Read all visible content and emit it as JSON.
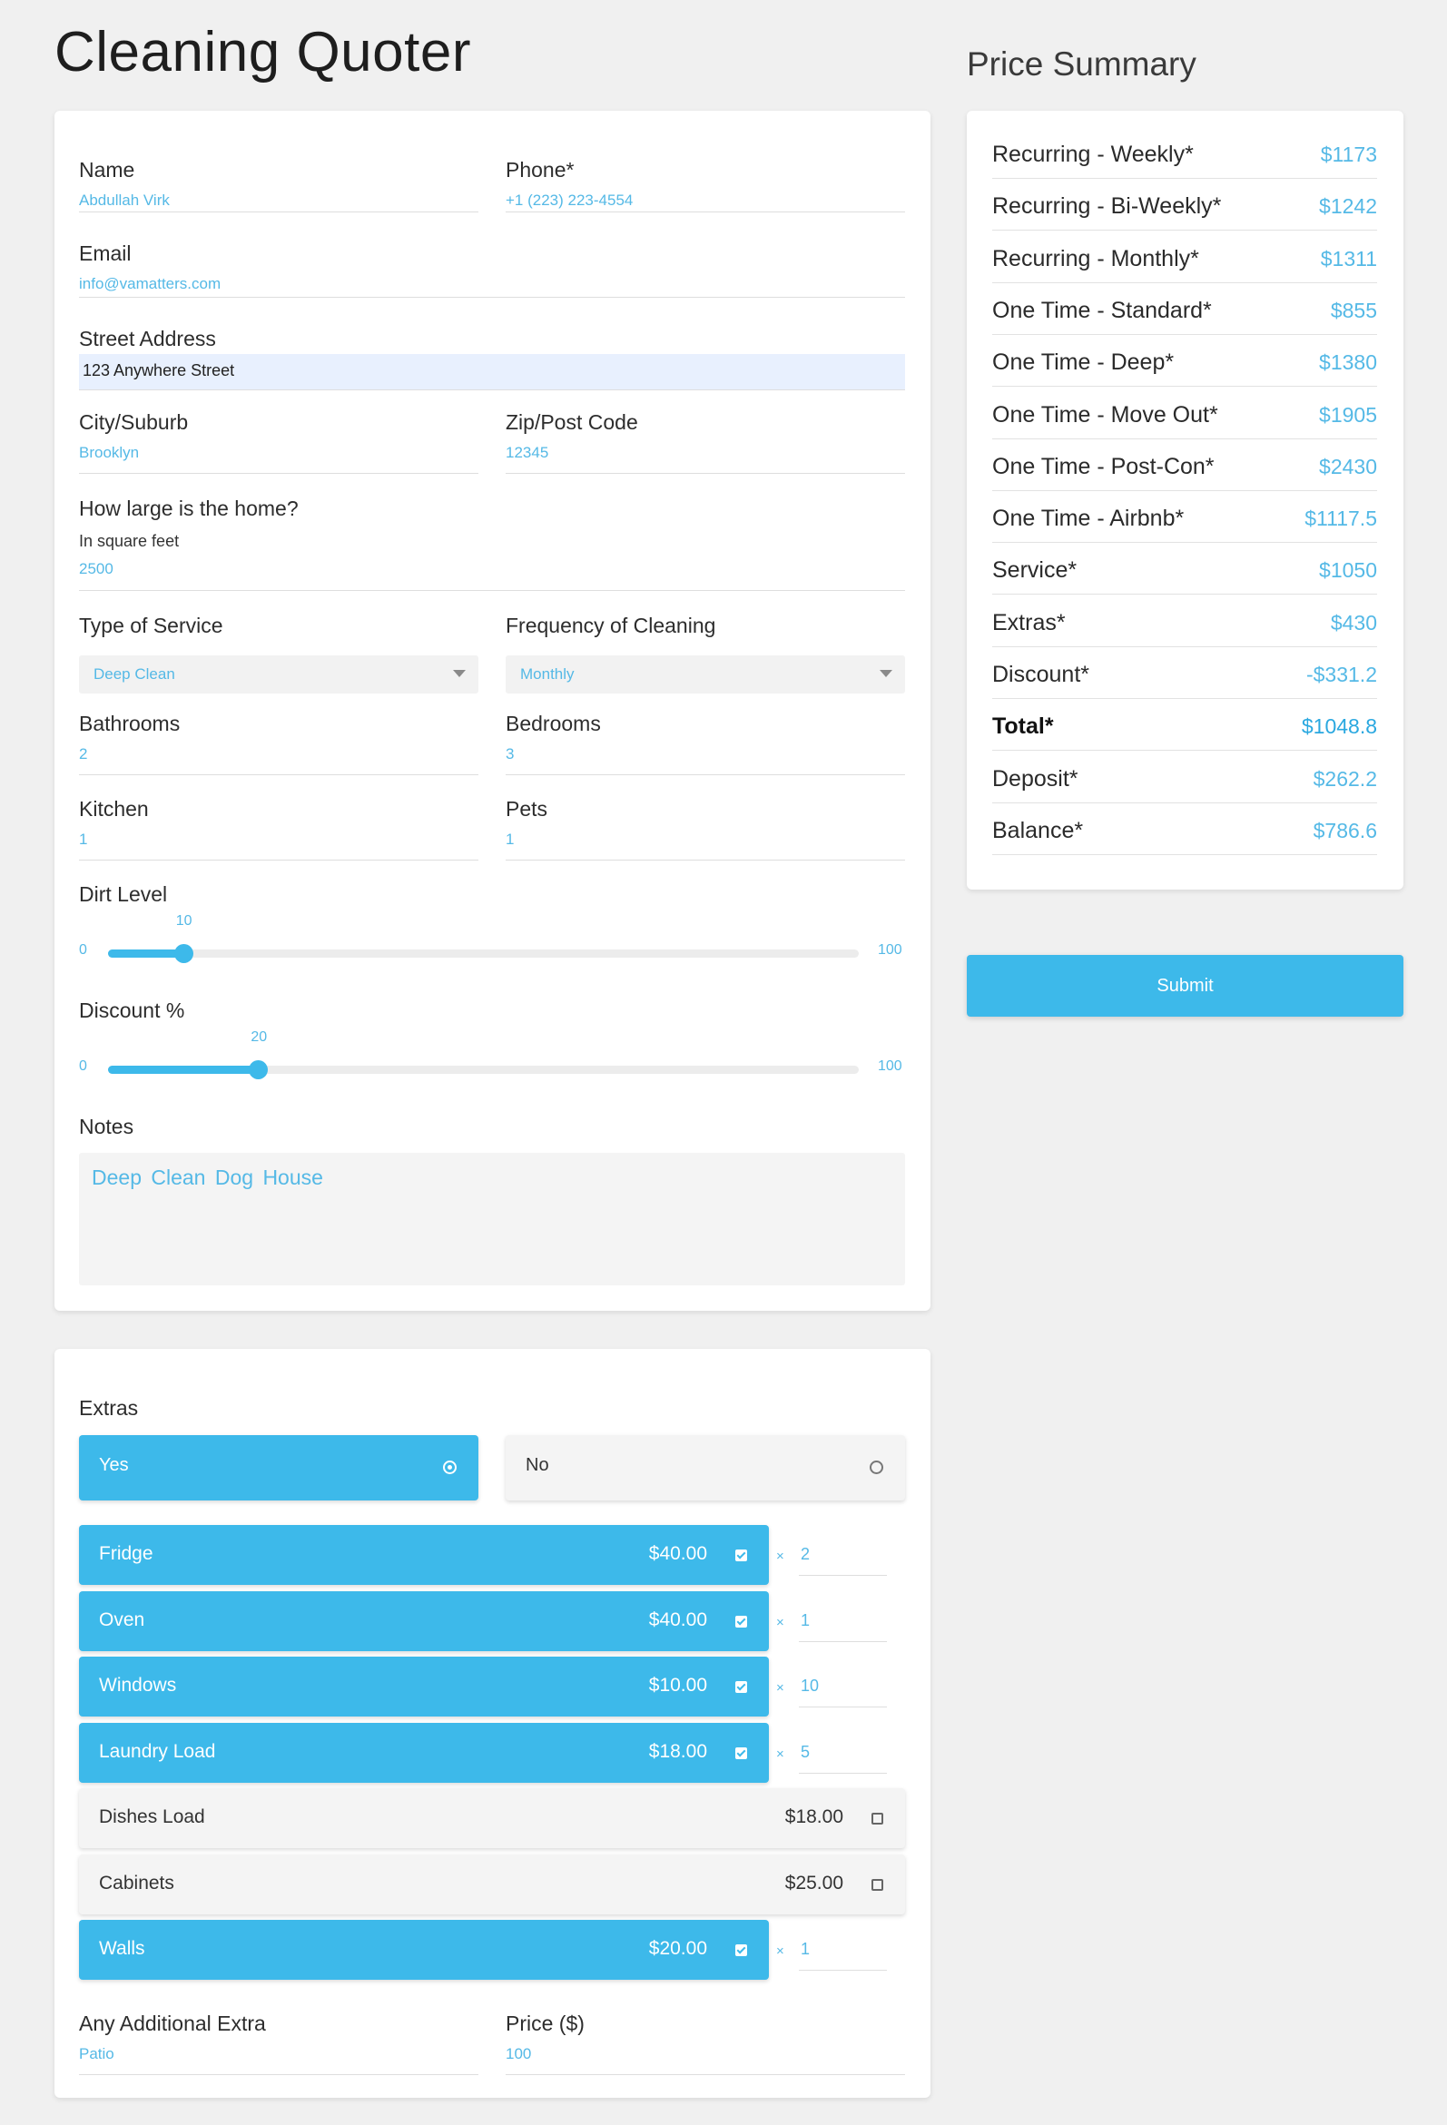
{
  "app": {
    "title": "Cleaning Quoter"
  },
  "form": {
    "name": {
      "label": "Name",
      "value": "Abdullah Virk"
    },
    "phone": {
      "label": "Phone*",
      "value": "+1 (223) 223-4554"
    },
    "email": {
      "label": "Email",
      "value": "info@vamatters.com"
    },
    "street": {
      "label": "Street Address",
      "value": "123 Anywhere Street"
    },
    "city": {
      "label": "City/Suburb",
      "value": "Brooklyn"
    },
    "zip": {
      "label": "Zip/Post Code",
      "value": "12345"
    },
    "home_size": {
      "label": "How large is the home?",
      "hint": "In square feet",
      "value": "2500"
    },
    "service_type": {
      "label": "Type of Service",
      "selected": "Deep Clean"
    },
    "frequency": {
      "label": "Frequency of Cleaning",
      "selected": "Monthly"
    },
    "bathrooms": {
      "label": "Bathrooms",
      "value": "2"
    },
    "bedrooms": {
      "label": "Bedrooms",
      "value": "3"
    },
    "kitchen": {
      "label": "Kitchen",
      "value": "1"
    },
    "pets": {
      "label": "Pets",
      "value": "1"
    },
    "dirt_level": {
      "label": "Dirt Level",
      "min": "0",
      "max": "100",
      "value": "10"
    },
    "discount": {
      "label": "Discount %",
      "min": "0",
      "max": "100",
      "value": "20"
    },
    "notes": {
      "label": "Notes",
      "value": "Deep Clean Dog House"
    }
  },
  "extras": {
    "label": "Extras",
    "yes_label": "Yes",
    "no_label": "No",
    "selected": "Yes",
    "items": [
      {
        "name": "Fridge",
        "price": "$40.00",
        "checked": true,
        "qty_symbol": "×",
        "qty": "2"
      },
      {
        "name": "Oven",
        "price": "$40.00",
        "checked": true,
        "qty_symbol": "×",
        "qty": "1"
      },
      {
        "name": "Windows",
        "price": "$10.00",
        "checked": true,
        "qty_symbol": "×",
        "qty": "10"
      },
      {
        "name": "Laundry Load",
        "price": "$18.00",
        "checked": true,
        "qty_symbol": "×",
        "qty": "5"
      },
      {
        "name": "Dishes Load",
        "price": "$18.00",
        "checked": false
      },
      {
        "name": "Cabinets",
        "price": "$25.00",
        "checked": false
      },
      {
        "name": "Walls",
        "price": "$20.00",
        "checked": true,
        "qty_symbol": "×",
        "qty": "1"
      }
    ],
    "additional": {
      "label": "Any Additional Extra",
      "value": "Patio"
    },
    "additional_price": {
      "label": "Price ($)",
      "value": "100"
    }
  },
  "summary": {
    "title": "Price Summary",
    "rows": [
      {
        "label": "Recurring - Weekly*",
        "value": "$1173"
      },
      {
        "label": "Recurring -  Bi-Weekly*",
        "value": "$1242"
      },
      {
        "label": "Recurring -  Monthly*",
        "value": "$1311"
      },
      {
        "label": "One Time - Standard*",
        "value": "$855"
      },
      {
        "label": "One Time -  Deep*",
        "value": "$1380"
      },
      {
        "label": "One Time -  Move Out*",
        "value": "$1905"
      },
      {
        "label": "One Time -  Post-Con*",
        "value": "$2430"
      },
      {
        "label": "One Time - Airbnb*",
        "value": "$1117.5"
      },
      {
        "label": "Service*",
        "value": "$1050"
      },
      {
        "label": "Extras*",
        "value": "$430"
      },
      {
        "label": "Discount*",
        "value": "-$331.2"
      },
      {
        "label": "Total*",
        "value": "$1048.8"
      },
      {
        "label": "Deposit*",
        "value": "$262.2"
      },
      {
        "label": "Balance*",
        "value": "$786.6"
      }
    ],
    "submit_label": "Submit"
  },
  "colors": {
    "accent": "#3db9ea",
    "value_text": "#55b9e6",
    "card_bg": "#ffffff",
    "page_bg": "#f0f0f0"
  }
}
